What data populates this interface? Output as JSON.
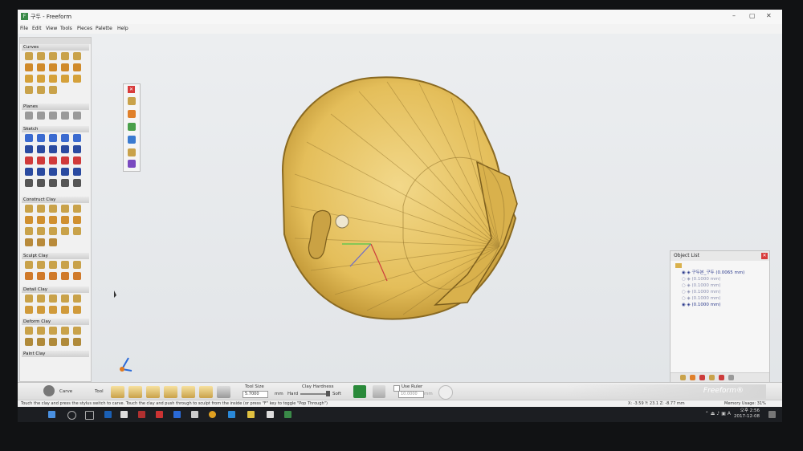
{
  "window": {
    "title": "구두 - Freeform",
    "menus": [
      "File",
      "Edit",
      "View",
      "Tools",
      "Pieces",
      "Palette",
      "Help"
    ]
  },
  "left_palette": {
    "sections": [
      "Curves",
      "Planes",
      "Sketch",
      "Construct Clay",
      "Sculpt Clay",
      "Detail Clay",
      "Deform Clay",
      "Paint Clay"
    ]
  },
  "object_list": {
    "title": "Object List",
    "rows": [
      "구두본_구두 (0.0065 mm)",
      "(0.1000 mm)",
      "(0.1000 mm)",
      "(0.1000 mm)",
      "(0.1000 mm)",
      "(0.1000 mm)"
    ]
  },
  "bottom_toolbar": {
    "tool_name": "Carve",
    "tool_label": "Tool",
    "tool_size_label": "Tool Size",
    "tool_size_value": "5.7000",
    "tool_size_unit": "mm",
    "clay_hardness_label": "Clay Hardness",
    "hard_label": "Hard",
    "soft_label": "Soft",
    "use_ruler_label": "Use Ruler",
    "ruler_value": "10.0000",
    "ruler_unit": "mm",
    "brand": "Freeform®"
  },
  "status_bar": {
    "hint": "Touch the clay and press the stylus switch to carve. Touch the clay and push through to sculpt from the inside (or press \"F\" key to toggle \"Pop Through\")",
    "coords": "X: -3.59   Y: 23.1   Z: -8.77   mm",
    "memory": "Memory Usage: 31%"
  },
  "taskbar": {
    "time": "오후 2:56",
    "date": "2017-12-08"
  },
  "colors": {
    "clay": "#e4be5a",
    "clay_dark": "#8a6a22",
    "close_red": "#d83b3b",
    "taskbar": "#1c1e22"
  }
}
